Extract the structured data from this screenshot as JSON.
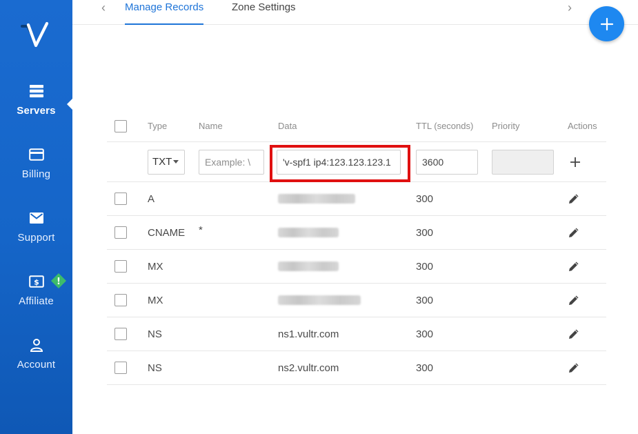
{
  "sidebar": {
    "items": [
      {
        "label": "Servers",
        "icon": "servers-icon",
        "active": true
      },
      {
        "label": "Billing",
        "icon": "billing-icon",
        "active": false
      },
      {
        "label": "Support",
        "icon": "support-icon",
        "active": false
      },
      {
        "label": "Affiliate",
        "icon": "affiliate-icon",
        "active": false,
        "badge": "!"
      },
      {
        "label": "Account",
        "icon": "account-icon",
        "active": false
      }
    ]
  },
  "tabs": [
    {
      "label": "Manage Records",
      "active": true
    },
    {
      "label": "Zone Settings",
      "active": false
    }
  ],
  "table": {
    "headers": {
      "type": "Type",
      "name": "Name",
      "data": "Data",
      "ttl": "TTL (seconds)",
      "priority": "Priority",
      "actions": "Actions"
    },
    "new_record": {
      "type": "TXT",
      "name_placeholder": "Example: \\",
      "data_value": "'v-spf1 ip4:123.123.123.1",
      "ttl_value": "3600",
      "priority_value": ""
    },
    "records": [
      {
        "type": "A",
        "name": "",
        "data": "",
        "ttl": "300",
        "blurred_width": 112
      },
      {
        "type": "CNAME",
        "name": "*",
        "data": "",
        "ttl": "300",
        "blurred_width": 88
      },
      {
        "type": "MX",
        "name": "",
        "data": "",
        "ttl": "300",
        "blurred_width": 88
      },
      {
        "type": "MX",
        "name": "",
        "data": "",
        "ttl": "300",
        "blurred_width": 120
      },
      {
        "type": "NS",
        "name": "",
        "data": "ns1.vultr.com",
        "ttl": "300"
      },
      {
        "type": "NS",
        "name": "",
        "data": "ns2.vultr.com",
        "ttl": "300"
      }
    ]
  },
  "colors": {
    "sidebar": "#1565c8",
    "accent": "#1e74d8",
    "fab": "#1e88f0",
    "highlight": "#e01010",
    "badge": "#3dbb6a"
  }
}
